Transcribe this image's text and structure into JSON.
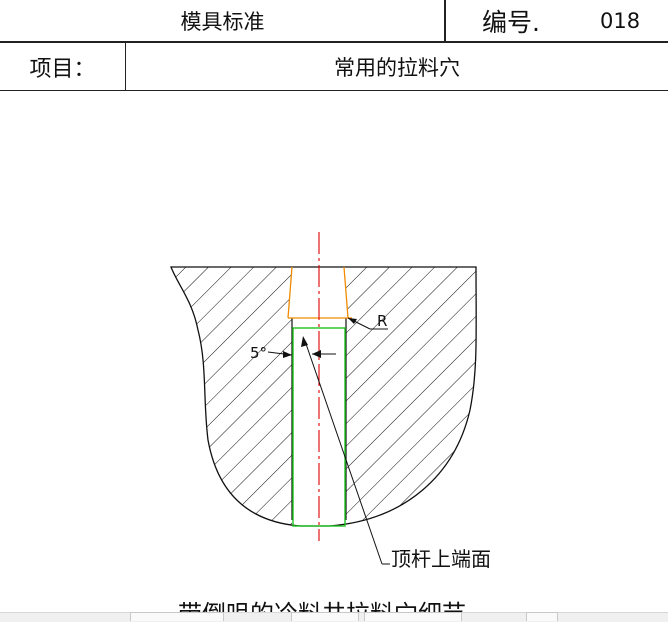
{
  "header": {
    "standard_title": "模具标准",
    "number_label": "编号.",
    "number_value": "018",
    "project_label": "项目：",
    "project_value": "常用的拉料穴"
  },
  "drawing": {
    "angle_label": "5°",
    "radius_label": "R",
    "callout_label": "顶杆上端面",
    "colors": {
      "outline": "#000000",
      "centerline": "#e00000",
      "taper": "#f08a00",
      "ejector_pin": "#1ec31e"
    }
  },
  "caption": {
    "text": "带倒咀的冷料井拉料穴细节"
  }
}
